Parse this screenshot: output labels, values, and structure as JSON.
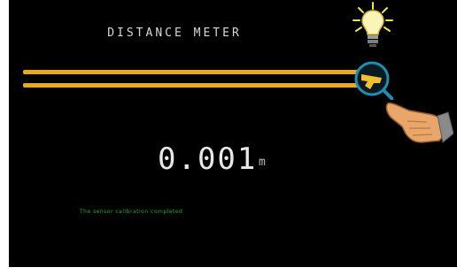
{
  "app": {
    "title": "DISTANCE METER"
  },
  "reading": {
    "value": "0.001",
    "unit": "m"
  },
  "status": {
    "message": "The sensor calibration completed"
  },
  "icons": {
    "light": "lightbulb-icon",
    "probe": "magnifier-probe-icon",
    "hand": "pointing-hand-icon"
  },
  "colors": {
    "background": "#000000",
    "rail": "#e8a820",
    "probe_ring": "#1e8fb0",
    "status_text": "#1fae2c",
    "bulb": "#f2e34a"
  }
}
